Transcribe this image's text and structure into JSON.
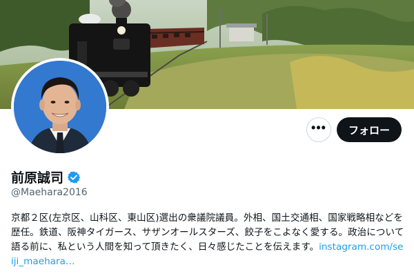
{
  "profile": {
    "name": "前原誠司",
    "handle": "@Maehara2016",
    "bio_text": "京都２区(左京区、山科区、東山区)選出の衆議院議員。外相、国土交通相、国家戦略相などを歴任。鉄道、阪神タイガース、サザンオールスターズ、餃子をこよなく愛する。政治について語る前に、私という人間を知って頂きたく、日々感じたことを伝えます。",
    "bio_link": "instagram.com/seiji_maehara…",
    "verified": true
  },
  "actions": {
    "more_label": "•••",
    "follow_label": "フォロー"
  },
  "icons": {
    "more": "more-icon",
    "verified": "verified-badge-icon"
  },
  "colors": {
    "follow_bg": "#0f1419",
    "link": "#1d9bf0",
    "verified": "#1d9bf0",
    "handle": "#536471"
  }
}
